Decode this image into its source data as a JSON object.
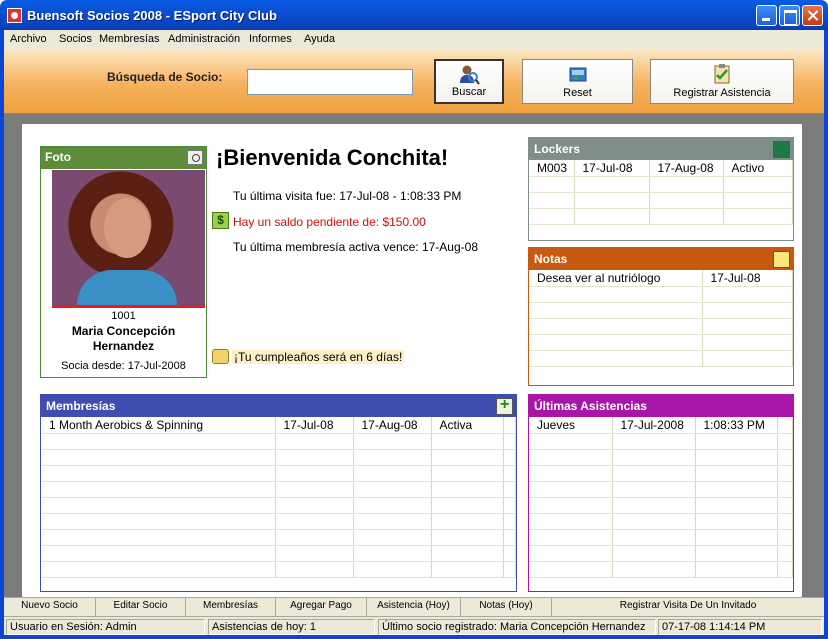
{
  "window": {
    "title": "Buensoft Socios 2008 - ESport City Club"
  },
  "menu": [
    "Archivo",
    "Socios",
    "Membresías",
    "Administración",
    "Informes",
    "Ayuda"
  ],
  "search": {
    "label": "Búsqueda de Socio:",
    "value": ""
  },
  "toolbar": {
    "buscar": "Buscar",
    "reset": "Reset",
    "registrar": "Registrar Asistencia"
  },
  "foto": {
    "title": "Foto",
    "socio_id": "1001",
    "name": "Maria Concepción Hernandez",
    "desde": "Socia desde: 17-Jul-2008"
  },
  "welcome": {
    "greeting": "¡Bienvenida Conchita!",
    "last_visit": "Tu última visita fue: 17-Jul-08 - 1:08:33 PM",
    "balance": "Hay un saldo pendiente de: $150.00",
    "membership_expires": "Tu última membresía activa vence: 17-Aug-08",
    "birthday": "¡Tu cumpleaños será en 6 días!",
    "dollar_symbol": "$"
  },
  "lockers": {
    "title": "Lockers",
    "rows": [
      [
        "M003",
        "17-Jul-08",
        "17-Aug-08",
        "Activo"
      ]
    ]
  },
  "notas": {
    "title": "Notas",
    "rows": [
      [
        "Desea ver al nutriólogo",
        "17-Jul-08"
      ]
    ]
  },
  "membresias": {
    "title": "Membresías",
    "rows": [
      [
        "1 Month Aerobics & Spinning",
        "17-Jul-08",
        "17-Aug-08",
        "Activa"
      ]
    ]
  },
  "asistencias": {
    "title": "Últimas Asistencias",
    "rows": [
      [
        "Jueves",
        "17-Jul-2008",
        "1:08:33 PM"
      ]
    ]
  },
  "tabs": [
    "Nuevo Socio",
    "Editar Socio",
    "Membresías",
    "Agregar Pago",
    "Asistencia (Hoy)",
    "Notas (Hoy)",
    "Registrar Visita De Un Invitado"
  ],
  "status": {
    "user": "Usuario en Sesión: Admin",
    "asistencias_hoy": "Asistencias de hoy: 1",
    "ultimo_socio": "Último socio registrado: Maria Concepción Hernandez",
    "datetime": "07-17-08 1:14:14 PM"
  },
  "colors": {
    "foto": "#5d8c3a",
    "lockers": "#7d8f88",
    "notas": "#c75a10",
    "membresias": "#3f4cb0",
    "asistencias": "#a915a8",
    "balance": "#cc1111"
  }
}
